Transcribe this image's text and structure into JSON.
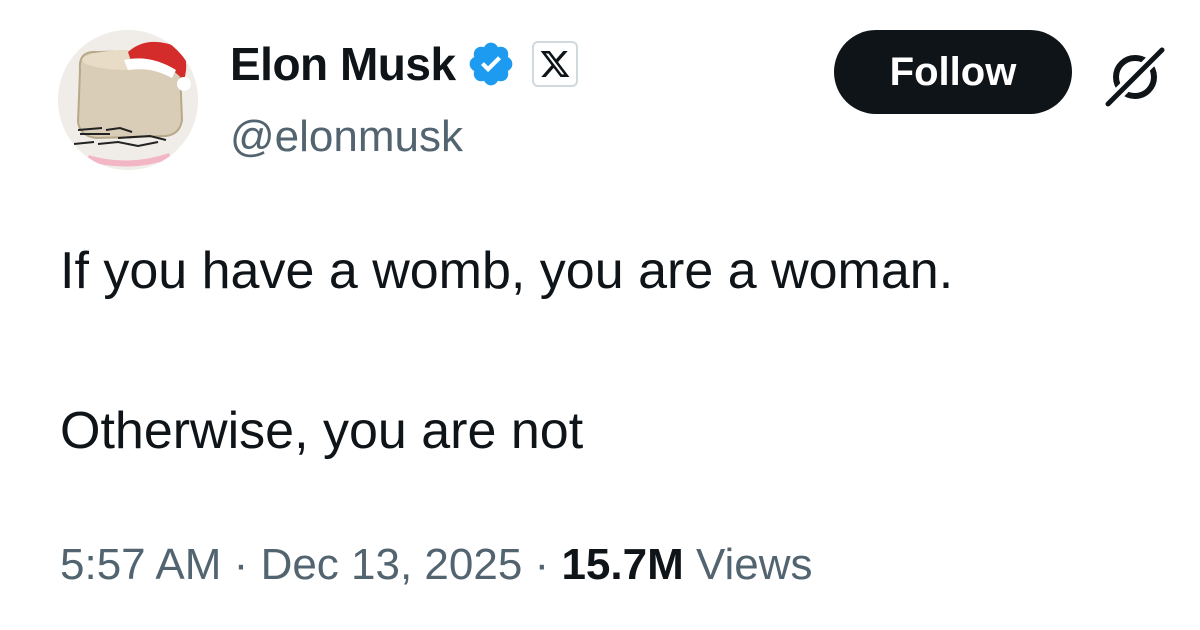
{
  "user": {
    "display_name": "Elon Musk",
    "handle": "@elonmusk",
    "avatar_icon": "avatar-santa-hat",
    "verified_icon": "verified-badge-icon",
    "affiliation_icon": "x-logo-icon"
  },
  "actions": {
    "follow_label": "Follow",
    "grok_icon": "grok-icon"
  },
  "tweet": {
    "lines": [
      "If you have a womb, you are a woman.",
      "Otherwise, you are not"
    ]
  },
  "meta": {
    "time": "5:57 AM",
    "separator": "·",
    "date": "Dec 13, 2025",
    "views_count": "15.7M",
    "views_label": "Views"
  },
  "colors": {
    "text": "#0f1419",
    "secondary": "#536471",
    "verified_blue": "#1d9bf0",
    "follow_bg": "#0f1419"
  }
}
